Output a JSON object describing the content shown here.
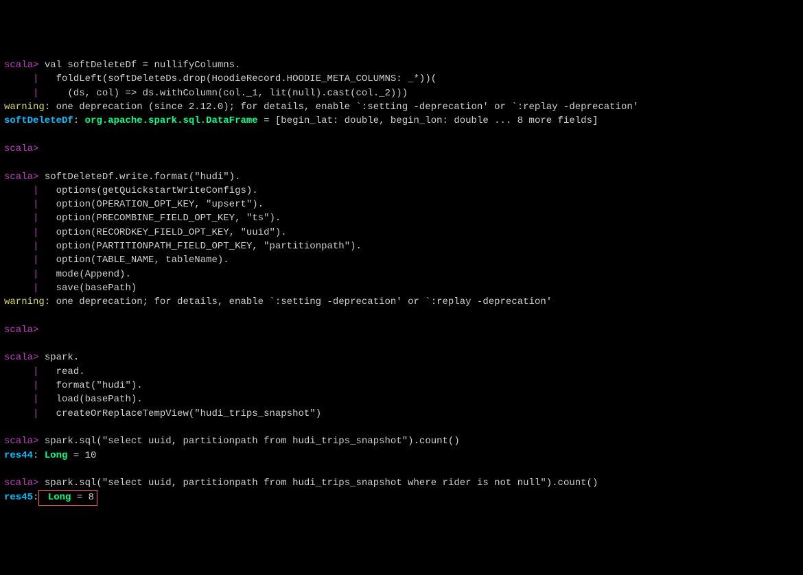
{
  "prompt": "scala>",
  "pipe": "     |",
  "block1": {
    "l1": " val softDeleteDf = nullifyColumns.",
    "l2": "   foldLeft(softDeleteDs.drop(HoodieRecord.HOODIE_META_COLUMNS: _*))(",
    "l3": "     (ds, col) => ds.withColumn(col._1, lit(null).cast(col._2)))"
  },
  "warning1": {
    "key": "warning",
    "text": ": one deprecation (since 2.12.0); for details, enable `:setting -deprecation' or `:replay -deprecation'"
  },
  "result1": {
    "name": "softDeleteDf",
    "colon": ": ",
    "type": "org.apache.spark.sql.DataFrame",
    "rest": " = [begin_lat: double, begin_lon: double ... 8 more fields]"
  },
  "block2": {
    "l1": " softDeleteDf.write.format(\"hudi\").",
    "l2": "   options(getQuickstartWriteConfigs).",
    "l3": "   option(OPERATION_OPT_KEY, \"upsert\").",
    "l4": "   option(PRECOMBINE_FIELD_OPT_KEY, \"ts\").",
    "l5": "   option(RECORDKEY_FIELD_OPT_KEY, \"uuid\").",
    "l6": "   option(PARTITIONPATH_FIELD_OPT_KEY, \"partitionpath\").",
    "l7": "   option(TABLE_NAME, tableName).",
    "l8": "   mode(Append).",
    "l9": "   save(basePath)"
  },
  "warning2": {
    "key": "warning",
    "text": ": one deprecation; for details, enable `:setting -deprecation' or `:replay -deprecation'"
  },
  "block3": {
    "l1": " spark.",
    "l2": "   read.",
    "l3": "   format(\"hudi\").",
    "l4": "   load(basePath).",
    "l5": "   createOrReplaceTempView(\"hudi_trips_snapshot\")"
  },
  "query1": {
    "code": " spark.sql(\"select uuid, partitionpath from hudi_trips_snapshot\").count()",
    "resname": "res44",
    "colon": ": ",
    "type": "Long",
    "rest": " = 10"
  },
  "query2": {
    "code": " spark.sql(\"select uuid, partitionpath from hudi_trips_snapshot where rider is not null\").count()",
    "resname": "res45",
    "colon": ":",
    "type": " Long ",
    "rest": "= 8"
  }
}
